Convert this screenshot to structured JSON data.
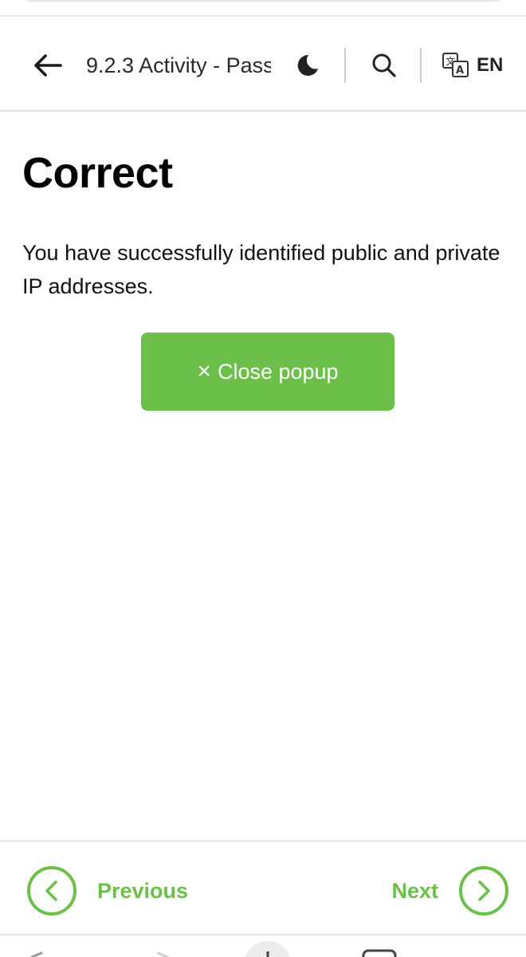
{
  "header": {
    "title": "9.2.3 Activity - Pass",
    "language": "EN",
    "icons": {
      "back": "arrow-left-icon",
      "theme": "moon-icon",
      "search": "search-icon",
      "translate": "translate-icon"
    }
  },
  "main": {
    "heading": "Correct",
    "message": "You have successfully identified public and private IP addresses.",
    "close_button": {
      "icon": "×",
      "label": "Close popup"
    }
  },
  "footer": {
    "previous_label": "Previous",
    "next_label": "Next"
  },
  "colors": {
    "accent_green": "#6cc04a",
    "text": "#111111",
    "divider": "#e4e4e4"
  }
}
